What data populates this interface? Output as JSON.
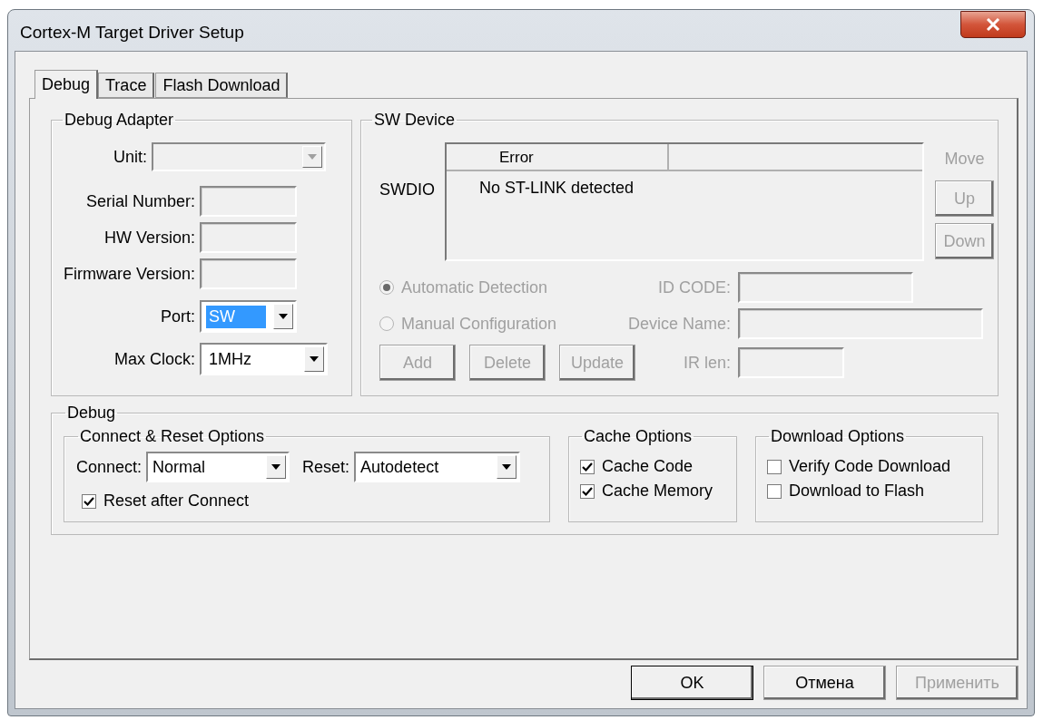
{
  "window": {
    "title": "Cortex-M Target Driver Setup"
  },
  "tabs": [
    {
      "label": "Debug",
      "selected": true
    },
    {
      "label": "Trace",
      "selected": false
    },
    {
      "label": "Flash Download",
      "selected": false
    }
  ],
  "debug_adapter": {
    "title": "Debug Adapter",
    "unit": {
      "label": "Unit:",
      "disabled": true
    },
    "info_fields": [
      {
        "label": "Serial Number:",
        "disabled": true
      },
      {
        "label": "HW Version:",
        "disabled": true
      },
      {
        "label": "Firmware Version:",
        "disabled": true
      }
    ],
    "port": {
      "label": "Port:",
      "value": "SW",
      "highlighted": true
    },
    "max_clock": {
      "label": "Max Clock:",
      "value": "1MHz",
      "highlighted": false
    }
  },
  "sw_device": {
    "title": "SW Device",
    "interface_label": "SWDIO",
    "list": {
      "columns": [
        "Error"
      ],
      "rows": [
        [
          "No ST-LINK detected"
        ]
      ]
    },
    "move": {
      "label": "Move",
      "buttons": [
        {
          "label": "Up",
          "disabled": true
        },
        {
          "label": "Down",
          "disabled": true
        }
      ]
    },
    "detection": [
      {
        "label": "Automatic Detection",
        "selected": true,
        "disabled": true
      },
      {
        "label": "Manual Configuration",
        "selected": false,
        "disabled": true
      }
    ],
    "fields": [
      {
        "label": "ID CODE:",
        "disabled": true
      },
      {
        "label": "Device Name:",
        "disabled": true
      },
      {
        "label": "IR len:",
        "disabled": true
      }
    ],
    "buttons": [
      {
        "label": "Add",
        "disabled": true
      },
      {
        "label": "Delete",
        "disabled": true
      },
      {
        "label": "Update",
        "disabled": true
      }
    ]
  },
  "debug": {
    "title": "Debug",
    "connect_reset": {
      "title": "Connect & Reset Options",
      "connect": {
        "label": "Connect:",
        "value": "Normal"
      },
      "reset": {
        "label": "Reset:",
        "value": "Autodetect"
      },
      "options": [
        {
          "label": "Reset after Connect",
          "checked": true
        }
      ]
    },
    "cache_options": {
      "title": "Cache Options",
      "options": [
        {
          "label": "Cache Code",
          "checked": true
        },
        {
          "label": "Cache Memory",
          "checked": true
        }
      ]
    },
    "download_options": {
      "title": "Download Options",
      "options": [
        {
          "label": "Verify Code Download",
          "checked": false
        },
        {
          "label": "Download to Flash",
          "checked": false
        }
      ]
    }
  },
  "buttons": [
    {
      "label": "OK",
      "default": true,
      "disabled": false
    },
    {
      "label": "Отмена",
      "default": false,
      "disabled": false
    },
    {
      "label": "Применить",
      "default": false,
      "disabled": true
    }
  ]
}
